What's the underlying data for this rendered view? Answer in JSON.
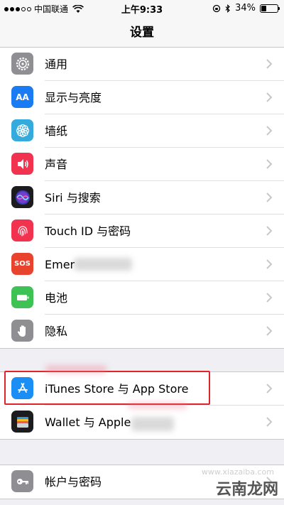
{
  "status_bar": {
    "carrier": "中国联通",
    "time": "上午9:33",
    "battery": "34%",
    "battery_level": 0.34
  },
  "nav": {
    "title": "设置"
  },
  "groups": [
    {
      "items": [
        {
          "label": "通用",
          "icon": "gear-icon",
          "color": "#8e8e93"
        },
        {
          "label": "显示与亮度",
          "icon": "text-size-icon",
          "color": "#1a7cf2",
          "glyph": "AA"
        },
        {
          "label": "墙纸",
          "icon": "flower-icon",
          "color": "#35aadc"
        },
        {
          "label": "声音",
          "icon": "speaker-icon",
          "color": "#f2334f"
        },
        {
          "label": "Siri 与搜索",
          "icon": "siri-icon",
          "color": "#1c1c1e"
        },
        {
          "label": "Touch ID 与密码",
          "icon": "fingerprint-icon",
          "color": "#f2334f"
        },
        {
          "label": "Emer",
          "icon": "sos-icon",
          "color": "#e8432d",
          "glyph": "SOS"
        },
        {
          "label": "电池",
          "icon": "battery-icon",
          "color": "#3ec254"
        },
        {
          "label": "隐私",
          "icon": "hand-icon",
          "color": "#8e8e93"
        }
      ]
    },
    {
      "items": [
        {
          "label": "iTunes Store 与 App Store",
          "icon": "app-store-icon",
          "color": "#1b8ef5"
        },
        {
          "label": "Wallet 与 Apple",
          "icon": "wallet-icon",
          "color": "#1c1c1e"
        }
      ]
    },
    {
      "items": [
        {
          "label": "帐户与密码",
          "icon": "key-icon",
          "color": "#8e8e93"
        }
      ]
    }
  ],
  "watermark": {
    "brand": "云南龙网",
    "faint": "www.xiazaiba.com"
  }
}
